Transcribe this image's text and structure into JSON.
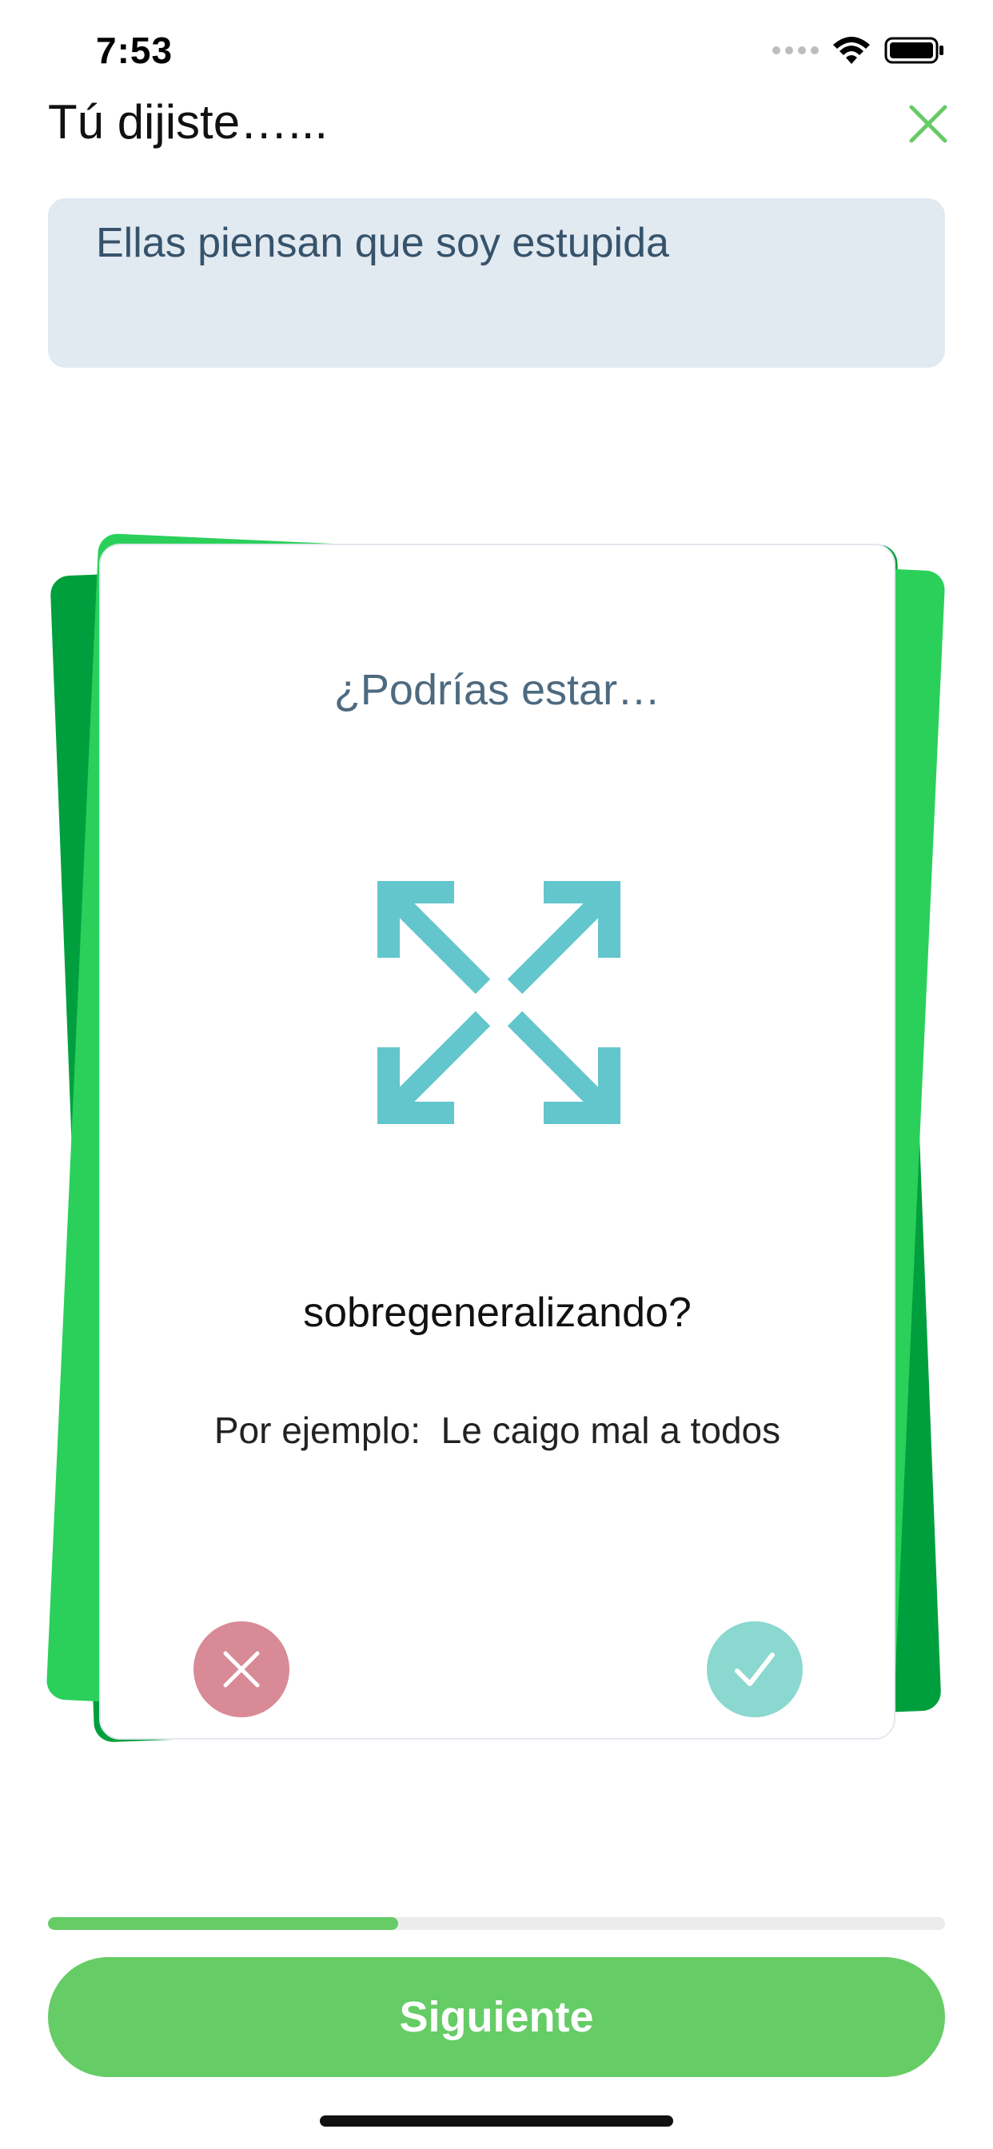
{
  "status_bar": {
    "time": "7:53"
  },
  "header": {
    "title": "Tú dijiste…...",
    "close_icon": "close-icon"
  },
  "said": {
    "text": "Ellas piensan que soy estupida"
  },
  "card": {
    "question": "¿Podrías estar…",
    "icon": "expand-arrows-icon",
    "label": "sobregeneralizando?",
    "example": "Por ejemplo:  Le caigo mal a todos",
    "reject_icon": "x-icon",
    "accept_icon": "check-icon"
  },
  "progress": {
    "fraction": 0.39
  },
  "footer": {
    "next_label": "Siguiente"
  },
  "colors": {
    "accent": "#66cc66",
    "icon_teal": "#62c6cc",
    "reject": "#d88a96",
    "accept": "#8ad8cf",
    "card_back_dark": "#009f3e",
    "card_back_light": "#2bd05b"
  }
}
